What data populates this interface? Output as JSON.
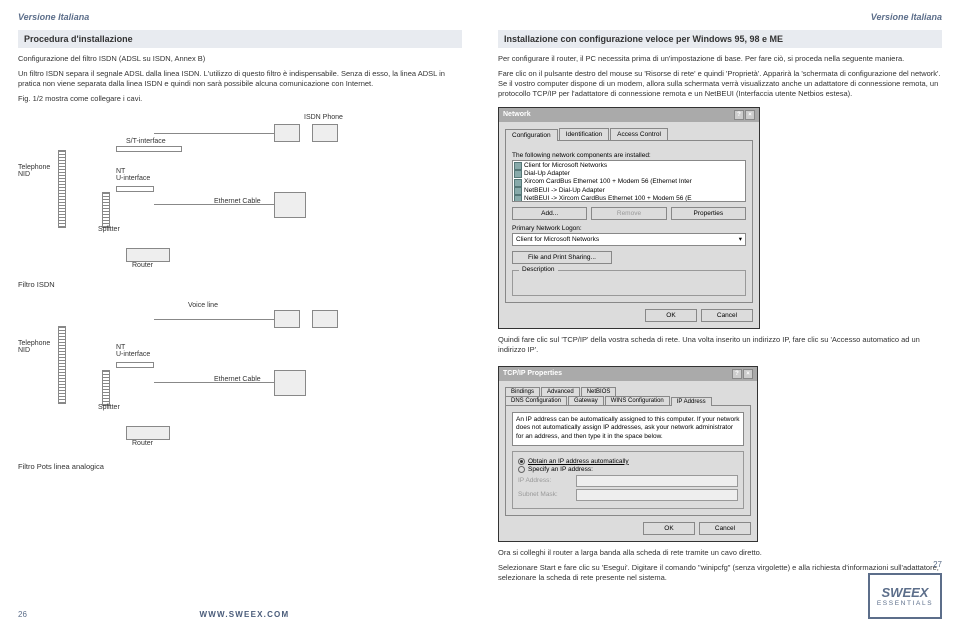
{
  "header_it": "Versione Italiana",
  "left": {
    "section1": "Procedura d'installazione",
    "p1": "Configurazione del filtro ISDN (ADSL su ISDN, Annex B)",
    "p2": "Un filtro ISDN separa il segnale ADSL dalla linea ISDN. L'utilizzo di questo filtro è indispensabile. Senza di esso, la linea ADSL in pratica non viene separata dalla linea ISDN e quindi non sarà possibile alcuna comunicazione con Internet.",
    "p3": "Fig. 1/2 mostra come collegare i cavi.",
    "diagram1": {
      "isdn_phone": "ISDN Phone",
      "st_interface": "S/T-interface",
      "telephone_nid": "Telephone\nNID",
      "nt_uinterface": "NT\nU-interface",
      "splitter": "Splitter",
      "ethernet_cable": "Ethernet Cable",
      "router": "Router"
    },
    "filtro_isdn": "Filtro ISDN",
    "diagram2": {
      "voice_line": "Voice line",
      "telephone_nid": "Telephone\nNID",
      "nt_uinterface": "NT\nU-interface",
      "splitter": "Splitter",
      "ethernet_cable": "Ethernet Cable",
      "router": "Router"
    },
    "filtro_pots": "Filtro Pots linea analogica",
    "page_num": "26",
    "url": "WWW.SWEEX.COM"
  },
  "right": {
    "section1": "Installazione con configurazione veloce per Windows 95, 98 e ME",
    "p1": "Per configurare il router, il PC necessita prima di un'impostazione di base. Per fare ciò, si proceda nella seguente maniera.",
    "p2": "Fare clic on il pulsante destro del mouse su 'Risorse di rete' e quindi 'Proprietà'. Apparirà la 'schermata di configurazione del network'. Se il vostro computer dispone di un modem, allora sulla schermata verrà visualizzato anche un adattatore di connessione remota, un protocollo TCP/IP per l'adattatore di connessione remota e un NetBEUI (Interfaccia utente Netbios estesa).",
    "network_dialog": {
      "title": "Network",
      "tab_config": "Configuration",
      "tab_ident": "Identification",
      "tab_access": "Access Control",
      "components_label": "The following network components are installed:",
      "items": [
        "Client for Microsoft Networks",
        "Dial-Up Adapter",
        "Xircom CardBus Ethernet 100 + Modem 56 (Ethernet Inter",
        "NetBEUI -> Dial-Up Adapter",
        "NetBEUI -> Xircom CardBus Ethernet 100 + Modem 56 (E"
      ],
      "btn_add": "Add...",
      "btn_remove": "Remove",
      "btn_props": "Properties",
      "logon_label": "Primary Network Logon:",
      "logon_value": "Client for Microsoft Networks",
      "btn_fps": "File and Print Sharing...",
      "desc_label": "Description",
      "ok": "OK",
      "cancel": "Cancel"
    },
    "p3": "Quindi fare clic sul 'TCP/IP' della vostra scheda di rete. Una volta inserito un indirizzo IP, fare clic su 'Accesso automatico ad un indirizzo IP'.",
    "tcpip_dialog": {
      "title": "TCP/IP Properties",
      "tabs_top": [
        "Bindings",
        "Advanced",
        "NetBIOS"
      ],
      "tabs_bottom": [
        "DNS Configuration",
        "Gateway",
        "WINS Configuration",
        "IP Address"
      ],
      "intro": "An IP address can be automatically assigned to this computer. If your network does not automatically assign IP addresses, ask your network administrator for an address, and then type it in the space below.",
      "radio_auto": "Obtain an IP address automatically",
      "radio_specify": "Specify an IP address:",
      "ip_label": "IP Address:",
      "subnet_label": "Subnet Mask:",
      "ok": "OK",
      "cancel": "Cancel"
    },
    "p4": "Ora si colleghi il router a larga banda alla scheda di rete tramite un cavo diretto.",
    "p5": "Selezionare Start e fare clic su 'Esegui'. Digitare il comando \"winipcfg\" (senza virgolette) e alla richiesta d'informazioni sull'adattatore, selezionare la scheda di rete presente nel sistema.",
    "page_num": "27",
    "logo_brand": "SWEEX",
    "logo_sub": "ESSENTIALS"
  }
}
